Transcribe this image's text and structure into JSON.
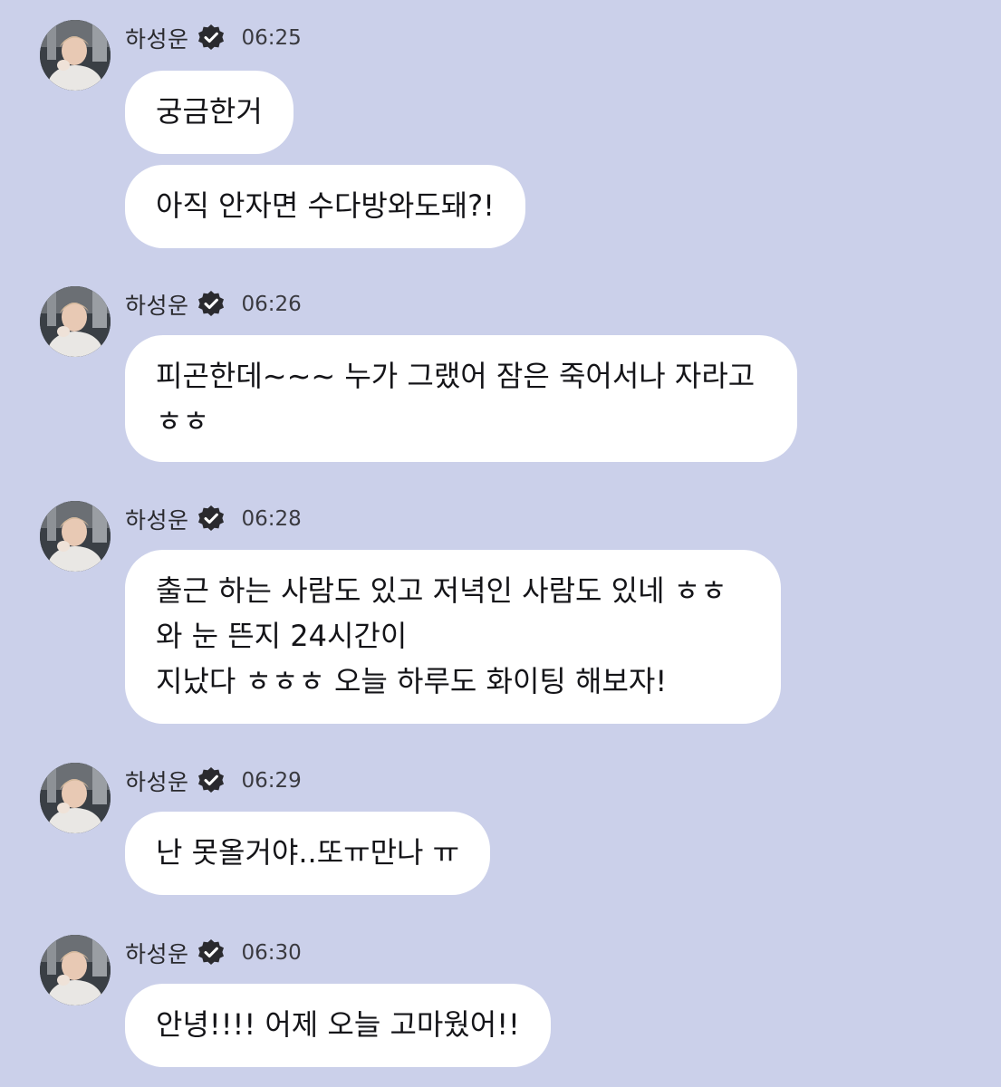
{
  "sender": {
    "name": "하성운",
    "avatar_icon": "avatar-photo",
    "verified_icon": "verified-badge-icon"
  },
  "messages": [
    {
      "time": "06:25",
      "bubbles": [
        "궁금한거",
        "아직 안자면 수다방와도돼?!"
      ]
    },
    {
      "time": "06:26",
      "bubbles": [
        "피곤한데~~~ 누가 그랬어 잠은 죽어서나 자라고\nㅎㅎ"
      ]
    },
    {
      "time": "06:28",
      "bubbles": [
        "출근 하는 사람도 있고 저녁인 사람도 있네 ㅎㅎ\n와 눈 뜬지 24시간이\n지났다 ㅎㅎㅎ 오늘 하루도 화이팅 해보자!"
      ]
    },
    {
      "time": "06:29",
      "bubbles": [
        "난 못올거야..또ㅠ만나 ㅠ"
      ]
    },
    {
      "time": "06:30",
      "bubbles": [
        "안녕!!!! 어제 오늘 고마웠어!!"
      ]
    }
  ],
  "colors": {
    "background": "#cbd0ea",
    "bubble": "#ffffff",
    "verified_badge": "#2a2a2e"
  }
}
